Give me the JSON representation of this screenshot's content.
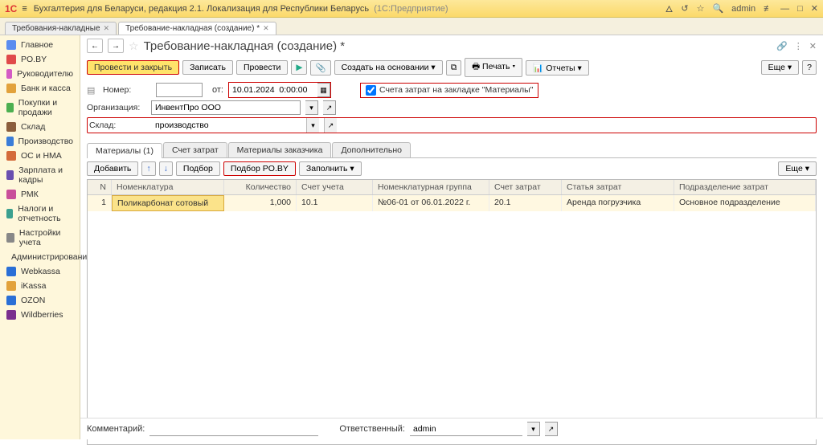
{
  "titlebar": {
    "app": "Бухгалтерия для Беларуси, редакция 2.1. Локализация для Республики Беларусь",
    "platform": "(1С:Предприятие)",
    "user": "admin"
  },
  "strip_tabs": [
    {
      "label": "Требования-накладные",
      "active": false
    },
    {
      "label": "Требование-накладная (создание) *",
      "active": true
    }
  ],
  "sidebar": [
    {
      "label": "Главное",
      "color": "#5b8def"
    },
    {
      "label": "PO.BY",
      "color": "#e04a4a"
    },
    {
      "label": "Руководителю",
      "color": "#d45bc4"
    },
    {
      "label": "Банк и касса",
      "color": "#e2a23b"
    },
    {
      "label": "Покупки и продажи",
      "color": "#4caf50"
    },
    {
      "label": "Склад",
      "color": "#8b5e3c"
    },
    {
      "label": "Производство",
      "color": "#3b7dd8"
    },
    {
      "label": "ОС и НМА",
      "color": "#d46b3b"
    },
    {
      "label": "Зарплата и кадры",
      "color": "#6a4fb0"
    },
    {
      "label": "РМК",
      "color": "#c94f9a"
    },
    {
      "label": "Налоги и отчетность",
      "color": "#3ba08f"
    },
    {
      "label": "Настройки учета",
      "color": "#888"
    },
    {
      "label": "Администрирование",
      "color": "#888"
    },
    {
      "label": "Webkassa",
      "color": "#2a6fd6"
    },
    {
      "label": "iKassa",
      "color": "#e2a23b"
    },
    {
      "label": "OZON",
      "color": "#2a6fd6"
    },
    {
      "label": "Wildberries",
      "color": "#7b2f8e"
    }
  ],
  "page": {
    "title": "Требование-накладная (создание) *"
  },
  "toolbar": {
    "post_close": "Провести и закрыть",
    "save": "Записать",
    "post": "Провести",
    "create_based": "Создать на основании",
    "print": "Печать",
    "reports": "Отчеты",
    "more": "Еще"
  },
  "form": {
    "number_label": "Номер:",
    "number": "",
    "date_label": "от:",
    "date": "10.01.2024  0:00:00",
    "org_label": "Организация:",
    "org": "ИнвентПро ООО",
    "wh_label": "Склад:",
    "wh": "производство",
    "cost_chk": "Счета затрат на закладке \"Материалы\""
  },
  "subtabs": [
    "Материалы (1)",
    "Счет затрат",
    "Материалы заказчика",
    "Дополнительно"
  ],
  "grid_toolbar": {
    "add": "Добавить",
    "pick": "Подбор",
    "pick_poby": "Подбор PO.BY",
    "fill": "Заполнить",
    "more": "Еще"
  },
  "grid": {
    "headers": [
      "N",
      "Номенклатура",
      "Количество",
      "Счет учета",
      "Номенклатурная группа",
      "Счет затрат",
      "Статья затрат",
      "Подразделение затрат"
    ],
    "rows": [
      {
        "n": "1",
        "nom": "Поликарбонат сотовый",
        "qty": "1,000",
        "acc": "10.1",
        "grp": "№06-01 от 06.01.2022 г.",
        "cost": "20.1",
        "art": "Аренда погрузчика",
        "dep": "Основное подразделение"
      }
    ]
  },
  "footer": {
    "comment_label": "Комментарий:",
    "comment": "",
    "resp_label": "Ответственный:",
    "resp": "admin"
  }
}
